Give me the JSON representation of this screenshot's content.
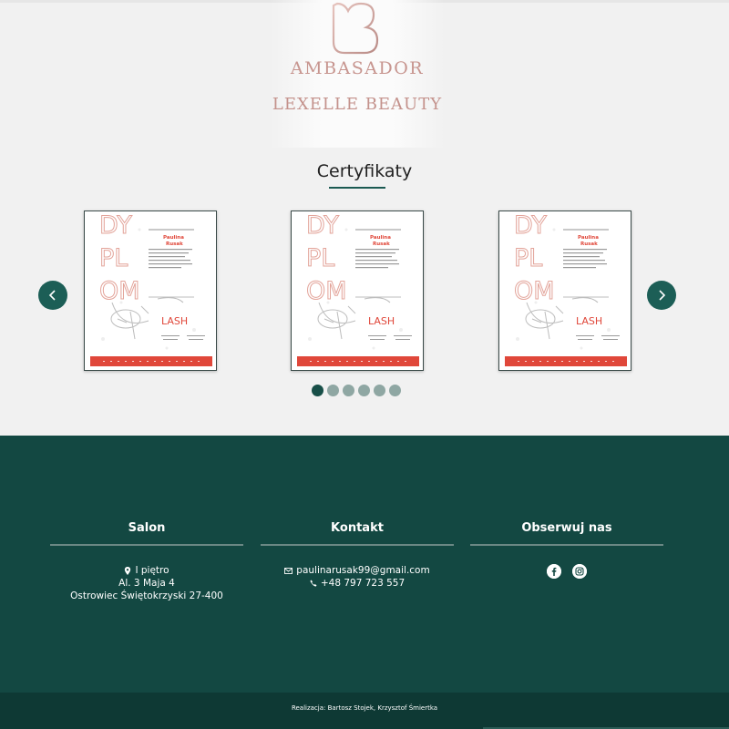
{
  "ambassador": {
    "title": "AMBASADOR",
    "subtitle": "LEXELLE BEAUTY"
  },
  "certificates": {
    "heading": "Certyfikaty",
    "prev_icon": "chevron-left-icon",
    "next_icon": "chevron-right-icon",
    "items": [
      {
        "letters": [
          "DY",
          "PL",
          "OM"
        ],
        "name_first": "Paulina",
        "name_last": "Rusak",
        "brand": "LASH"
      },
      {
        "letters": [
          "DY",
          "PL",
          "OM"
        ],
        "name_first": "Paulina",
        "name_last": "Rusak",
        "brand": "LASH"
      },
      {
        "letters": [
          "DY",
          "PL",
          "OM"
        ],
        "name_first": "Paulina",
        "name_last": "Rusak",
        "brand": "LASH"
      }
    ],
    "dots_count": 6,
    "active_dot": 0
  },
  "footer": {
    "salon": {
      "title": "Salon",
      "floor": "I piętro",
      "street": "Al. 3 Maja 4",
      "city": "Ostrowiec Świętokrzyski 27-400"
    },
    "contact": {
      "title": "Kontakt",
      "email": "paulinarusak99@gmail.com",
      "phone": "+48 797 723 557"
    },
    "follow": {
      "title": "Obserwuj nas",
      "icons": [
        "facebook-icon",
        "instagram-icon"
      ]
    }
  },
  "credits": "Realizacja: Bartosz Stojek, Krzysztof Śmiertka",
  "colors": {
    "brand_green": "#134842",
    "accent_rose": "#c7958f",
    "cert_red": "#e0473a"
  }
}
